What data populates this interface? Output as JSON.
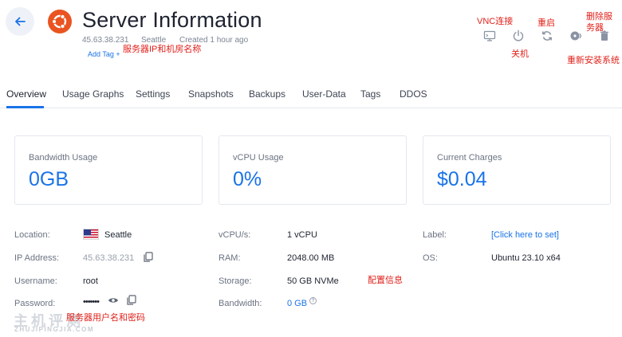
{
  "header": {
    "title": "Server Information",
    "ip": "45.63.38.231",
    "location": "Seattle",
    "created": "Created 1 hour ago",
    "add_tag": "Add Tag +"
  },
  "annotations": {
    "ip_room": "服务器IP和机房名称",
    "vnc": "VNC连接",
    "shutdown": "关机",
    "restart": "重启",
    "reinstall": "重新安装系统",
    "delete": "删除服务器",
    "config": "配置信息",
    "credentials": "服务器用户名和密码"
  },
  "tabs": [
    "Overview",
    "Usage Graphs",
    "Settings",
    "Snapshots",
    "Backups",
    "User-Data",
    "Tags",
    "DDOS"
  ],
  "cards": [
    {
      "label": "Bandwidth Usage",
      "value": "0GB"
    },
    {
      "label": "vCPU Usage",
      "value": "0%"
    },
    {
      "label": "Current Charges",
      "value": "$0.04"
    }
  ],
  "details": {
    "location_label": "Location:",
    "location_value": "Seattle",
    "ip_label": "IP Address:",
    "ip_value": "45.63.38.231",
    "username_label": "Username:",
    "username_value": "root",
    "password_label": "Password:",
    "password_value": "•••••••",
    "vcpu_label": "vCPU/s:",
    "vcpu_value": "1 vCPU",
    "ram_label": "RAM:",
    "ram_value": "2048.00 MB",
    "storage_label": "Storage:",
    "storage_value": "50 GB NVMe",
    "bandwidth_label": "Bandwidth:",
    "bandwidth_value": "0 GB",
    "label_label": "Label:",
    "label_value": "[Click here to set]",
    "os_label": "OS:",
    "os_value": "Ubuntu 23.10 x64"
  },
  "watermark": {
    "main": "主机评测",
    "sub": "ZHUJIPINGJIA.COM"
  },
  "colors": {
    "accent": "#1a73e8",
    "annotation": "#e0211b",
    "ubuntu": "#e95420"
  },
  "icons": {
    "back": "arrow-left-icon",
    "logo": "ubuntu-logo-icon",
    "vnc": "monitor-icon",
    "power": "power-icon",
    "restart": "refresh-icon",
    "reinstall": "disc-icon",
    "delete": "trash-icon",
    "flag": "us-flag-icon",
    "copy": "copy-icon",
    "eye": "eye-icon",
    "help": "question-icon"
  }
}
